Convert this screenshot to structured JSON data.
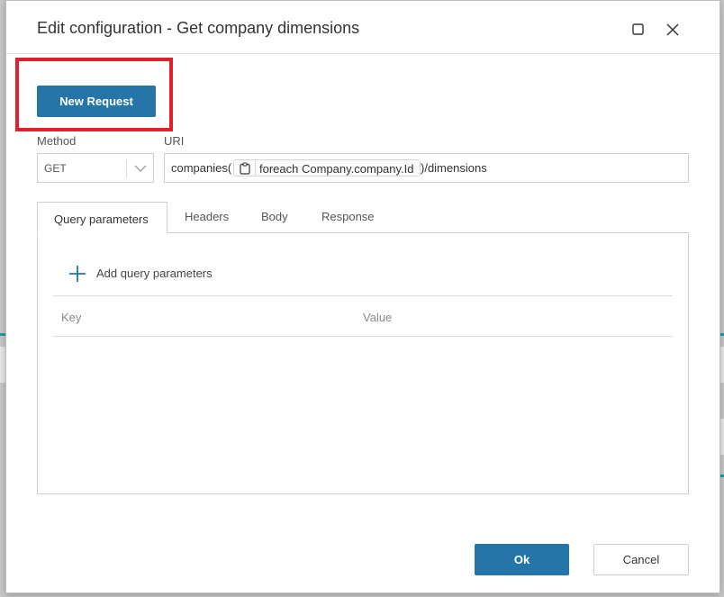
{
  "dialog": {
    "title": "Edit configuration - Get company dimensions",
    "maximize_icon": "maximize-icon",
    "close_icon": "close-icon"
  },
  "toolbar": {
    "new_request_label": "New Request"
  },
  "request": {
    "method_label": "Method",
    "method_value": "GET",
    "uri_label": "URI",
    "uri_prefix": "companies(",
    "uri_token_icon": "clipboard-icon",
    "uri_token_text": "foreach Company.company.Id",
    "uri_suffix": ")/dimensions"
  },
  "tabs": [
    {
      "label": "Query parameters",
      "active": true
    },
    {
      "label": "Headers",
      "active": false
    },
    {
      "label": "Body",
      "active": false
    },
    {
      "label": "Response",
      "active": false
    }
  ],
  "query_params": {
    "add_label": "Add query parameters",
    "columns": [
      "Key",
      "Value"
    ],
    "rows": []
  },
  "footer": {
    "ok_label": "Ok",
    "cancel_label": "Cancel"
  },
  "colors": {
    "primary": "#2575a8",
    "highlight": "#e0202a"
  }
}
